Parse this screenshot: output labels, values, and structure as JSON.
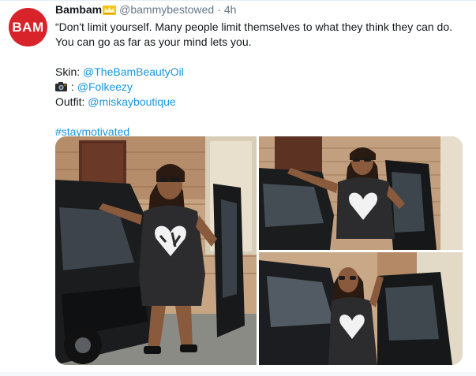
{
  "avatar": {
    "text": "BAM",
    "color": "#d8232a"
  },
  "tweet": {
    "display_name": "Bambam",
    "badge_icon": "crown-icon",
    "handle": "@bammybestowed",
    "separator": "·",
    "time": "4h",
    "text_line1": "“Don't limit yourself. Many people limit themselves to what they think they can do.",
    "text_line2": "You can go as far as your mind lets you.",
    "credits": [
      {
        "label": "Skin: ",
        "link": "@TheBamBeautyOil"
      },
      {
        "icon": "camera-icon",
        "label": ": ",
        "link": "@Folkeezy"
      },
      {
        "label": "Outfit: ",
        "link": "@miskayboutique"
      }
    ],
    "hashtag": "#staymotivated",
    "link_color": "#1b95e0"
  },
  "media": {
    "photos": [
      {
        "name": "woman-by-black-car-full"
      },
      {
        "name": "woman-by-car-door-top"
      },
      {
        "name": "woman-by-car-side-bottom"
      }
    ]
  }
}
